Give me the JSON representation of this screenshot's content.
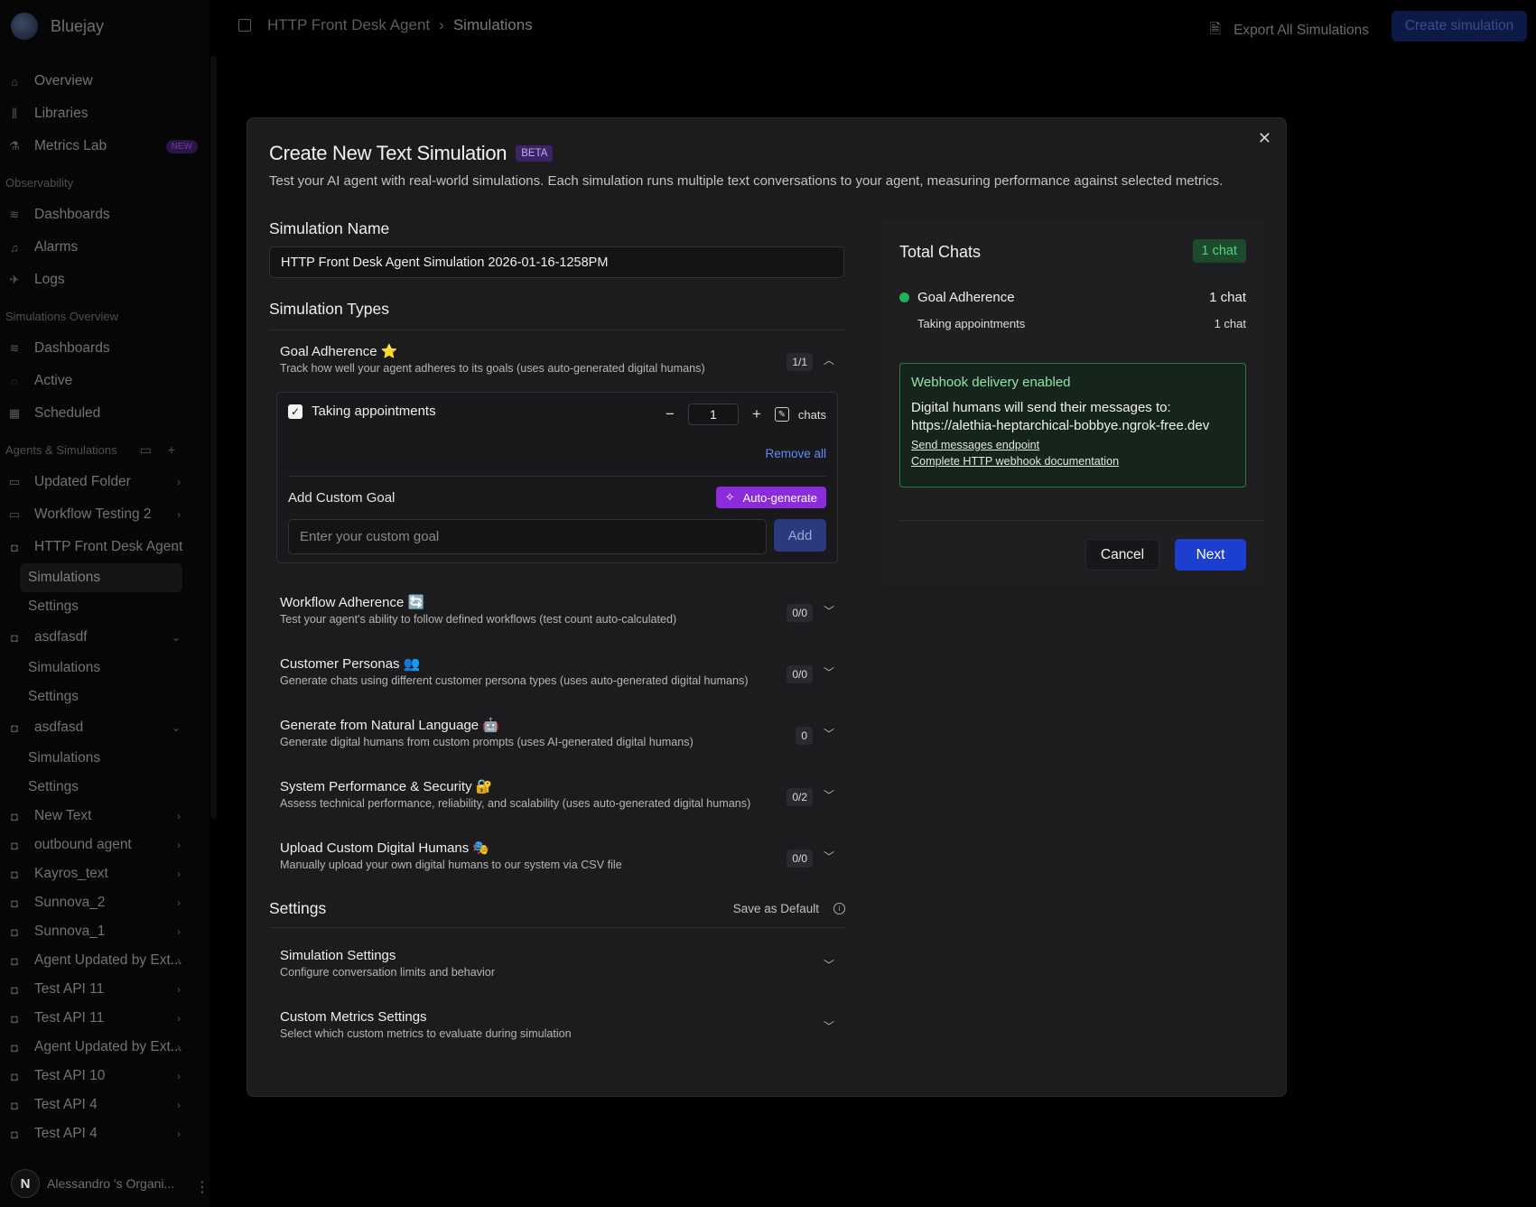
{
  "brand": {
    "name": "Bluejay"
  },
  "sidebar": {
    "top_items": [
      {
        "label": "Overview",
        "icon": "home-icon"
      },
      {
        "label": "Libraries",
        "icon": "library-icon"
      },
      {
        "label": "Metrics Lab",
        "icon": "flask-icon",
        "badge": "NEW"
      }
    ],
    "observability": {
      "title": "Observability",
      "items": [
        "Dashboards",
        "Alarms",
        "Logs"
      ]
    },
    "sim_overview": {
      "title": "Simulations Overview",
      "items": [
        "Dashboards",
        "Active",
        "Scheduled"
      ]
    },
    "agents": {
      "title": "Agents & Simulations",
      "folders": [
        "Updated Folder",
        "Workflow Testing 2"
      ],
      "expanded": [
        {
          "label": "HTTP Front Desk Agent",
          "subs": [
            "Simulations",
            "Settings"
          ]
        },
        {
          "label": "asdfasdf",
          "subs": [
            "Simulations",
            "Settings"
          ]
        },
        {
          "label": "asdfasd",
          "subs": [
            "Simulations",
            "Settings"
          ]
        }
      ],
      "collapsed": [
        "New Text",
        "outbound agent",
        "Kayros_text",
        "Sunnova_2",
        "Sunnova_1",
        "Agent Updated by Ext...",
        "Test API 11",
        "Test API 11",
        "Agent Updated by Ext...",
        "Test API 10",
        "Test API 4",
        "Test API 4"
      ]
    },
    "footer": {
      "avatar": "N",
      "org": "Alessandro 's Organi..."
    }
  },
  "header": {
    "breadcrumb": [
      "HTTP Front Desk Agent",
      "Simulations"
    ],
    "export_label": "Export All Simulations",
    "create_label": "Create simulation"
  },
  "modal": {
    "title": "Create New Text Simulation",
    "badge": "BETA",
    "description": "Test your AI agent with real-world simulations. Each simulation runs multiple text conversations to your agent, measuring performance against selected metrics.",
    "name_label": "Simulation Name",
    "name_value": "HTTP Front Desk Agent Simulation 2026-01-16-1258PM",
    "types_label": "Simulation Types",
    "goal": {
      "title": "Goal Adherence ⭐",
      "desc": "Track how well your agent adheres to its goals (uses auto-generated digital humans)",
      "count": "1/1",
      "item_label": "Taking appointments",
      "item_count": "1",
      "chats_label": "chats",
      "remove_all": "Remove all",
      "custom_label": "Add Custom Goal",
      "autogen_label": "Auto-generate",
      "custom_placeholder": "Enter your custom goal",
      "add_label": "Add"
    },
    "types": [
      {
        "title": "Workflow Adherence 🔄",
        "desc": "Test your agent's ability to follow defined workflows (test count auto-calculated)",
        "count": "0/0"
      },
      {
        "title": "Customer Personas 👥",
        "desc": "Generate chats using different customer persona types (uses auto-generated digital humans)",
        "count": "0/0"
      },
      {
        "title": "Generate from Natural Language 🤖",
        "desc": "Generate digital humans from custom prompts (uses AI-generated digital humans)",
        "count": "0"
      },
      {
        "title": "System Performance & Security 🔐",
        "desc": "Assess technical performance, reliability, and scalability (uses auto-generated digital humans)",
        "count": "0/2"
      },
      {
        "title": "Upload Custom Digital Humans 🎭",
        "desc": "Manually upload your own digital humans to our system via CSV file",
        "count": "0/0"
      }
    ],
    "settings": {
      "title": "Settings",
      "save_default": "Save as Default",
      "items": [
        {
          "title": "Simulation Settings",
          "desc": "Configure conversation limits and behavior"
        },
        {
          "title": "Custom Metrics Settings",
          "desc": "Select which custom metrics to evaluate during simulation"
        }
      ]
    },
    "summary": {
      "title": "Total Chats",
      "badge": "1 chat",
      "goal_label": "Goal Adherence",
      "goal_count": "1 chat",
      "sub_label": "Taking appointments",
      "sub_count": "1 chat"
    },
    "webhook": {
      "title": "Webhook delivery enabled",
      "text": "Digital humans will send their messages to:",
      "url": "https://alethia-heptarchical-bobbye.ngrok-free.dev",
      "link1": "Send messages endpoint",
      "link2": "Complete HTTP webhook documentation"
    },
    "cancel_label": "Cancel",
    "next_label": "Next"
  },
  "colors": {
    "accent": "#1d3fcf",
    "autogen": "#8b2bd9",
    "success": "#22b35a",
    "beta": "#3b2464"
  }
}
